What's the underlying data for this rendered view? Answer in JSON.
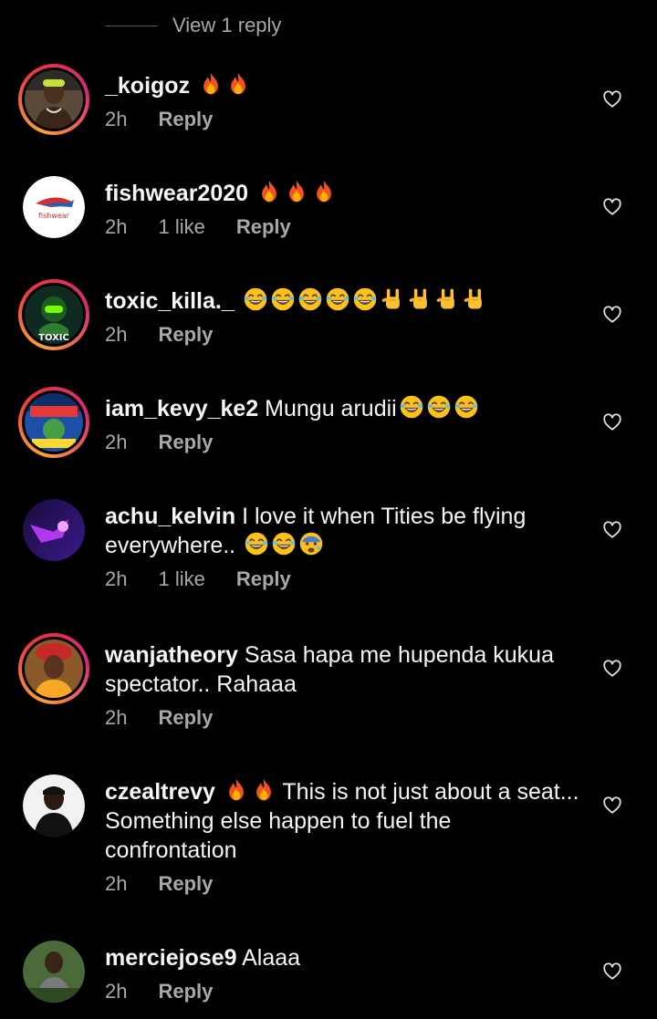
{
  "thread": {
    "view_replies_label": "View 1 reply"
  },
  "comments": [
    {
      "username": "_koigoz",
      "text": "",
      "emojis": [
        "fire",
        "fire"
      ],
      "time": "2h",
      "likes": "",
      "reply_label": "Reply"
    },
    {
      "username": "fishwear2020",
      "text": "",
      "emojis": [
        "fire",
        "fire",
        "fire"
      ],
      "time": "2h",
      "likes": "1 like",
      "reply_label": "Reply"
    },
    {
      "username": "toxic_killa._",
      "text": "",
      "emojis": [
        "joy",
        "joy",
        "joy",
        "joy",
        "joy",
        "rock",
        "rock",
        "rock",
        "rock"
      ],
      "time": "2h",
      "likes": "",
      "reply_label": "Reply"
    },
    {
      "username": "iam_kevy_ke2",
      "text": "Mungu arudii",
      "emojis": [
        "joy",
        "joy",
        "joy"
      ],
      "time": "2h",
      "likes": "",
      "reply_label": "Reply"
    },
    {
      "username": "achu_kelvin",
      "text": "I love it when Tities be flying everywhere..",
      "emojis": [
        "joy",
        "joy",
        "fearful"
      ],
      "time": "2h",
      "likes": "1 like",
      "reply_label": "Reply"
    },
    {
      "username": "wanjatheory",
      "text": "Sasa hapa me hupenda kukua spectator.. Rahaaa",
      "emojis": [],
      "time": "2h",
      "likes": "",
      "reply_label": "Reply"
    },
    {
      "username": "czealtrevy",
      "text": "This is not just about a seat... Something else happen to fuel the confrontation",
      "emojis_before_text": [
        "fire",
        "fire"
      ],
      "time": "2h",
      "likes": "",
      "reply_label": "Reply"
    },
    {
      "username": "merciejose9",
      "text": "Alaaa",
      "emojis": [],
      "time": "2h",
      "likes": "",
      "reply_label": "Reply"
    }
  ],
  "avatars": {
    "fishwear_logo_text": "fishwear",
    "toxic_logo_text": "TOXIC"
  },
  "icons": {
    "like": "heart-outline-icon"
  },
  "colors": {
    "background": "#000000",
    "text": "#f5f5f5",
    "muted": "#a8a8a8"
  }
}
